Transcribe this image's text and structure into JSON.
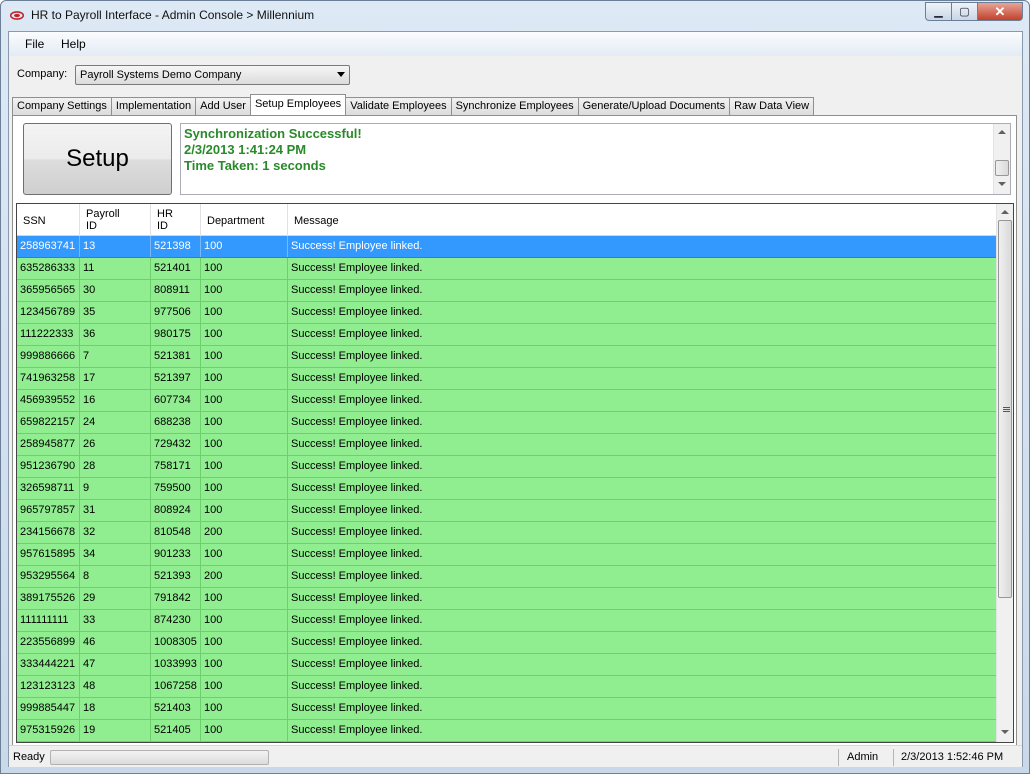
{
  "window": {
    "title": "HR to Payroll Interface - Admin Console > Millennium",
    "controls": {
      "minimize": "▁",
      "maximize": "▢",
      "close": "✕"
    }
  },
  "menu": {
    "file": "File",
    "help": "Help"
  },
  "company": {
    "label": "Company:",
    "selected": "Payroll Systems Demo Company"
  },
  "tabs": [
    "Company Settings",
    "Implementation",
    "Add User",
    "Setup Employees",
    "Validate Employees",
    "Synchronize Employees",
    "Generate/Upload Documents",
    "Raw Data View"
  ],
  "active_tab": "Setup Employees",
  "setup_button": "Setup",
  "messages": [
    "Synchronization Successful!",
    "2/3/2013 1:41:24 PM",
    "Time Taken: 1 seconds"
  ],
  "grid": {
    "columns": [
      "SSN",
      "Payroll\nID",
      "HR\nID",
      "Department",
      "Message"
    ],
    "rows": [
      [
        "258963741",
        "13",
        "521398",
        "100",
        "Success! Employee linked."
      ],
      [
        "635286333",
        "11",
        "521401",
        "100",
        "Success! Employee linked."
      ],
      [
        "365956565",
        "30",
        "808911",
        "100",
        "Success! Employee linked."
      ],
      [
        "123456789",
        "35",
        "977506",
        "100",
        "Success! Employee linked."
      ],
      [
        "111222333",
        "36",
        "980175",
        "100",
        "Success! Employee linked."
      ],
      [
        "999886666",
        "7",
        "521381",
        "100",
        "Success! Employee linked."
      ],
      [
        "741963258",
        "17",
        "521397",
        "100",
        "Success! Employee linked."
      ],
      [
        "456939552",
        "16",
        "607734",
        "100",
        "Success! Employee linked."
      ],
      [
        "659822157",
        "24",
        "688238",
        "100",
        "Success! Employee linked."
      ],
      [
        "258945877",
        "26",
        "729432",
        "100",
        "Success! Employee linked."
      ],
      [
        "951236790",
        "28",
        "758171",
        "100",
        "Success! Employee linked."
      ],
      [
        "326598711",
        "9",
        "759500",
        "100",
        "Success! Employee linked."
      ],
      [
        "965797857",
        "31",
        "808924",
        "100",
        "Success! Employee linked."
      ],
      [
        "234156678",
        "32",
        "810548",
        "200",
        "Success! Employee linked."
      ],
      [
        "957615895",
        "34",
        "901233",
        "100",
        "Success! Employee linked."
      ],
      [
        "953295564",
        "8",
        "521393",
        "200",
        "Success! Employee linked."
      ],
      [
        "389175526",
        "29",
        "791842",
        "100",
        "Success! Employee linked."
      ],
      [
        "111111111",
        "33",
        "874230",
        "100",
        "Success! Employee linked."
      ],
      [
        "223556899",
        "46",
        "1008305",
        "100",
        "Success! Employee linked."
      ],
      [
        "333444221",
        "47",
        "1033993",
        "100",
        "Success! Employee linked."
      ],
      [
        "123123123",
        "48",
        "1067258",
        "100",
        "Success! Employee linked."
      ],
      [
        "999885447",
        "18",
        "521403",
        "100",
        "Success! Employee linked."
      ],
      [
        "975315926",
        "19",
        "521405",
        "100",
        "Success! Employee linked."
      ]
    ],
    "selected_row": 0
  },
  "status": {
    "text": "Ready",
    "user": "Admin",
    "datetime": "2/3/2013 1:52:46 PM"
  },
  "colors": {
    "row_success": "#90ee90",
    "row_selected": "#3399ff",
    "message_text": "#2a8a2a"
  }
}
